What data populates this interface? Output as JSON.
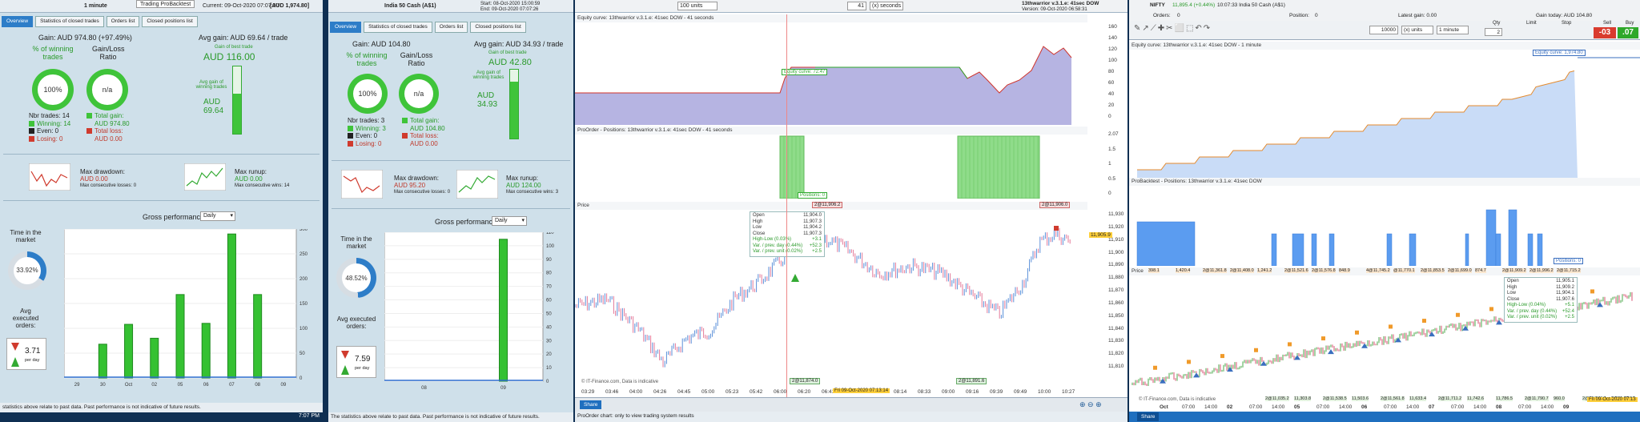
{
  "panel1": {
    "window_title": "1 minute",
    "popup_title": "Trading ProBacktest",
    "time_info": "Current: 09-Oct-2020 07:07:00",
    "balance": "[AUD 1,974.80]",
    "tabs": [
      "Overview",
      "Statistics of closed trades",
      "Orders list",
      "Closed positions list"
    ],
    "gain": "Gain: AUD 974.80 (+97.49%)",
    "win_pct_label": "% of winning trades",
    "win_pct_value": "100%",
    "gain_loss_label": "Gain/Loss Ratio",
    "gain_loss_value": "n/a",
    "avg_gain": "Avg gain: AUD 69.64 / trade",
    "gain_best_label": "Gain of best trade",
    "gain_best_value": "AUD 116.00",
    "avg_gain_winning_label": "Avg gain of winning trades",
    "avg_gain_winning_value": "AUD 69.64",
    "nbr_trades": "Nbr trades: 14",
    "winning": "Winning: 14",
    "even": "Even: 0",
    "losing": "Losing: 0",
    "total_gain": "Total gain:",
    "total_gain_value": "AUD 974.80",
    "total_loss": "Total loss:",
    "total_loss_value": "AUD 0.00",
    "max_drawdown_label": "Max drawdown:",
    "max_drawdown_value": "AUD 0.00",
    "max_consec_losses": "Max consecutive losses: 0",
    "max_runup_label": "Max runup:",
    "max_runup_value": "AUD 0.00",
    "max_consec_wins": "Max consecutive wins: 14",
    "time_in_market_label": "Time in the market",
    "time_in_market_value": "33.92%",
    "avg_exec_label": "Avg executed orders:",
    "avg_exec_value": "3.71",
    "per_day": "per day",
    "gross_perf_label": "Gross performance",
    "gross_perf_period": "Daily",
    "footer": "statistics above relate to past data. Past performance is not indicative of future results.",
    "clock": "7:07 PM"
  },
  "chart1": {
    "type": "bar",
    "categories": [
      "29",
      "30",
      "Oct",
      "02",
      "05",
      "06",
      "07",
      "08",
      "09"
    ],
    "values": [
      0,
      68,
      108,
      80,
      168,
      110,
      290,
      168,
      0
    ],
    "ylim": [
      0,
      300
    ],
    "yticks": [
      "300",
      "250",
      "200",
      "150",
      "100",
      "50",
      "0"
    ]
  },
  "panel2": {
    "window_title": "India 50 Cash (A$1)",
    "start": "Start: 08-Oct-2020 15:00:59",
    "end": "End: 09-Oct-2020 07:07:26",
    "tabs": [
      "Overview",
      "Statistics of closed trades",
      "Orders list",
      "Closed positions list"
    ],
    "gain": "Gain: AUD 104.80",
    "win_pct_label": "% of winning trades",
    "win_pct_value": "100%",
    "gain_loss_label": "Gain/Loss Ratio",
    "gain_loss_value": "n/a",
    "avg_gain": "Avg gain: AUD 34.93 / trade",
    "gain_best_label": "Gain of best trade",
    "gain_best_value": "AUD 42.80",
    "avg_gain_winning_label": "Avg gain of winning trades",
    "avg_gain_winning_value": "AUD 34.93",
    "nbr_trades": "Nbr trades: 3",
    "winning": "Winning: 3",
    "even": "Even: 0",
    "losing": "Losing: 0",
    "total_gain": "Total gain:",
    "total_gain_value": "AUD 104.80",
    "total_loss": "Total loss:",
    "total_loss_value": "AUD 0.00",
    "max_drawdown_label": "Max drawdown:",
    "max_drawdown_value": "AUD 95.20",
    "max_consec_losses": "Max consecutive losses: 0",
    "max_runup_label": "Max runup:",
    "max_runup_value": "AUD 124.00",
    "max_consec_wins": "Max consecutive wins: 3",
    "time_in_market_label": "Time in the market",
    "time_in_market_value": "48.52%",
    "avg_exec_label": "Avg executed orders:",
    "avg_exec_value": "7.59",
    "per_day": "per day",
    "gross_perf_label": "Gross performance",
    "gross_perf_period": "Daily",
    "footer": "The statistics above relate to past data. Past performance is not indicative of future results."
  },
  "chart2": {
    "type": "bar",
    "categories": [
      "08",
      "09"
    ],
    "values": [
      0,
      104.8
    ],
    "ylim": [
      0,
      110
    ],
    "yticks": [
      "110",
      "100",
      "90",
      "80",
      "70",
      "60",
      "50",
      "40",
      "30",
      "20",
      "10",
      "0"
    ]
  },
  "panel3": {
    "units": "100 units",
    "seconds": "41",
    "seconds_unit": "(x) seconds",
    "system_name": "13thwarrior v.3.1.e: 41sec DOW",
    "version": "Version: 09-Oct-2020 06:58:31",
    "equity_label": "Equity curve: 13thwarrior v.3.1.e: 41sec DOW - 41 seconds",
    "equity_badge": "Equity curve: 72.47",
    "equity_yticks": [
      "160",
      "140",
      "120",
      "100",
      "80",
      "60",
      "40",
      "20",
      "0"
    ],
    "positions_label": "ProOrder - Positions: 13thwarrior v.3.1.e: 41sec DOW - 41 seconds",
    "positions_badge": "Positions: 0",
    "positions_yticks": [
      "2.07",
      "1.5",
      "1",
      "0.5",
      "0"
    ],
    "price_label": "Price",
    "price_yticks": [
      "11,930",
      "11,920",
      "11,910",
      "11,900",
      "11,890",
      "11,880",
      "11,870",
      "11,860",
      "11,850",
      "11,840",
      "11,830",
      "11,820",
      "11,810"
    ],
    "price_marker_top": "2@11,906.2",
    "price_marker_top2": "2@11,906.0",
    "price_marker_bot": "2@11,874.0",
    "price_marker_bot2": "2@11,891.6",
    "price_current": "11,905.9",
    "ohlc": {
      "open": [
        "Open",
        "11,904.0"
      ],
      "high": [
        "High",
        "11,907.3"
      ],
      "low": [
        "Low",
        "11,904.2"
      ],
      "close": [
        "Close",
        "11,907.3"
      ],
      "hl": [
        "High-Low (0.03%)",
        "+3.1"
      ],
      "var_day": [
        "Var. / prev. day (0.44%)",
        "+52.3"
      ],
      "var_unit": [
        "Var. / prev. unit (0.02%)",
        "+2.5"
      ]
    },
    "watermark": "© IT-Finance.com, Data is indicative",
    "time_axis": [
      "03:29",
      "03:46",
      "04:00",
      "04:26",
      "04:45",
      "05:00",
      "05:23",
      "05:42",
      "06:00",
      "06:20",
      "06:41",
      "07:13:14",
      "08:00",
      "08:14",
      "08:33",
      "09:00",
      "09:16",
      "09:39",
      "09:49",
      "10:00",
      "10:27"
    ],
    "cursor_time": "Fri 09-Oct-2020 07:13:14",
    "share_btn": "Share",
    "footer": "ProOrder chart: only to view trading system results"
  },
  "panel4": {
    "instrument": "NIFTY",
    "price_line": "11,895.4 (+0.44%)",
    "time_line": "10:07:33 India 50 Cash (A$1)",
    "orders_label": "Orders:",
    "orders_value": "0",
    "position_label": "Position:",
    "position_value": "0",
    "latest_gain": "Latest gain: 0.00",
    "gain_today": "Gain today: AUD 104.80",
    "qty_label": "Qty",
    "limit_label": "Limit",
    "stop_label": "Stop",
    "sell_label": "Sell",
    "buy_label": "Buy",
    "sell_price": "-03",
    "buy_price": ".07",
    "units_value": "10000",
    "units_unit": "(x) units",
    "interval": "1 minute",
    "qty_value": "2",
    "equity_label": "Equity curve: 13thwarrior v.3.1.e: 41sec DOW - 1 minute",
    "equity_badge": "Equity curve: 1,974.80",
    "positions_label": "ProBacktest - Positions: 13thwarrior v.3.1.e: 41sec DOW",
    "positions_badge": "Positions: 0",
    "price_label": "Price",
    "markers_top": [
      "398.1",
      "1,420.4",
      "2@11,361.8",
      "2@11,408.0",
      "1,241.2",
      "2@11,521.6",
      "2@11,576.8",
      "848.9",
      "4@11,745.2",
      "@11,770.1",
      "2@11,853.5",
      "2@11,699.0",
      "874.7",
      "2@11,909.2",
      "2@11,996.2",
      "2@11,715.2"
    ],
    "markers_bot": [
      "2@11,035.2",
      "11,303.8",
      "2@11,538.5",
      "11,503.6",
      "2@11,561.8",
      "11,633.4",
      "2@11,711.2",
      "11,742.6",
      "11,786.5",
      "2@11,790.7",
      "960.0",
      "2@11,844.4",
      "2@11,874.0"
    ],
    "ohlc": {
      "open": [
        "Open",
        "11,905.1"
      ],
      "high": [
        "High",
        "11,909.2"
      ],
      "low": [
        "Low",
        "11,904.1"
      ],
      "close": [
        "Close",
        "11,907.6"
      ],
      "hl": [
        "High-Low (0.04%)",
        "+5.1"
      ],
      "var_day": [
        "Var. / prev. day (0.44%)",
        "+52.4"
      ],
      "var_unit": [
        "Var. / prev. unit (0.02%)",
        "+2.5"
      ]
    },
    "watermark": "© IT-Finance.com, Data is indicative",
    "time_axis": [
      "Oct",
      "07:00",
      "14:00",
      "02",
      "07:00",
      "14:00",
      "05",
      "07:00",
      "14:00",
      "06",
      "07:00",
      "14:00",
      "07",
      "07:00",
      "14:00",
      "08",
      "07:00",
      "14:00",
      "09"
    ],
    "cursor_time": "Fri 09-Oct-2020 07:13",
    "share_btn": "Share"
  }
}
